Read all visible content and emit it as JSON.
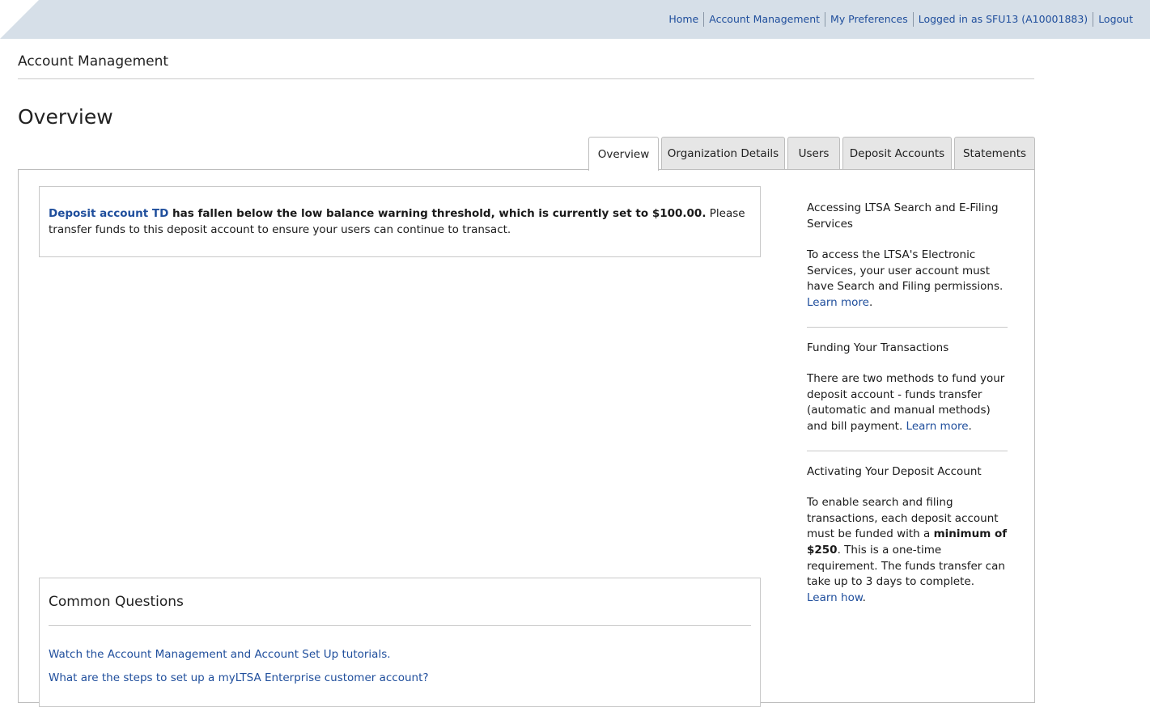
{
  "topnav": {
    "home": "Home",
    "account_management": "Account Management",
    "preferences": "My Preferences",
    "logged_in": "Logged in as SFU13 (A10001883)",
    "logout": "Logout"
  },
  "section_title": "Account Management",
  "page_title": "Overview",
  "tabs": [
    {
      "label": "Overview",
      "active": true
    },
    {
      "label": "Organization Details",
      "active": false
    },
    {
      "label": "Users",
      "active": false
    },
    {
      "label": "Deposit Accounts",
      "active": false
    },
    {
      "label": "Statements",
      "active": false
    }
  ],
  "alert": {
    "link": "Deposit account TD",
    "bold_text": " has fallen below the low balance warning threshold, which is currently set to $100.00.",
    "text": " Please transfer funds to this deposit account to ensure your users can continue to transact."
  },
  "common_questions": {
    "title": "Common Questions",
    "links": [
      "Watch the Account Management and Account Set Up tutorials.",
      "What are the steps to set up a myLTSA Enterprise customer account?"
    ]
  },
  "sidebar": {
    "block1": {
      "heading": "Accessing LTSA Search and E-Filing Services",
      "text": "To access the LTSA's Electronic Services, your user account must have Search and Filing permissions. ",
      "link": "Learn more",
      "end": "."
    },
    "block2": {
      "heading": "Funding Your Transactions",
      "text": "There are two methods to fund your deposit account - funds transfer (automatic and manual methods) and bill payment. ",
      "link": "Learn more",
      "end": "."
    },
    "block3": {
      "heading": "Activating Your Deposit Account",
      "text_before": "To enable search and filing transactions, each deposit account must be funded with a ",
      "bold": "minimum of $250",
      "text_after": ". This is a one-time requirement. The funds transfer can take up to 3 days to complete. ",
      "link": "Learn how",
      "end": "."
    }
  },
  "colors": {
    "topbar": "#d6dfe8",
    "link": "#1f4e9c",
    "tab_inactive": "#e6e6e6",
    "border": "#bdbdbd"
  }
}
